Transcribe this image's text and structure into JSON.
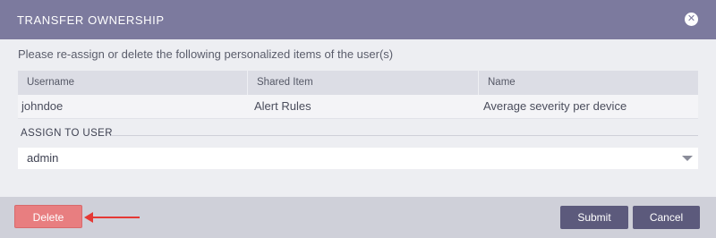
{
  "dialog": {
    "title": "TRANSFER OWNERSHIP",
    "close_glyph": "✕",
    "intro": "Please re-assign or delete the following personalized items of the user(s)"
  },
  "table": {
    "columns": [
      "Username",
      "Shared Item",
      "Name"
    ],
    "rows": [
      [
        "johndoe",
        "Alert Rules",
        "Average severity per device"
      ]
    ]
  },
  "assign": {
    "label": "ASSIGN TO USER",
    "selected": "admin"
  },
  "footer": {
    "delete_label": "Delete",
    "submit_label": "Submit",
    "cancel_label": "Cancel"
  },
  "colors": {
    "header_bg": "#7c7a9e",
    "delete_bg": "#e87e80",
    "primary_btn": "#5c5a7c",
    "annotation_arrow": "#e53935"
  },
  "icons": {
    "close": "close-icon",
    "dropdown": "chevron-down-icon",
    "annotation": "arrow-left-icon"
  }
}
